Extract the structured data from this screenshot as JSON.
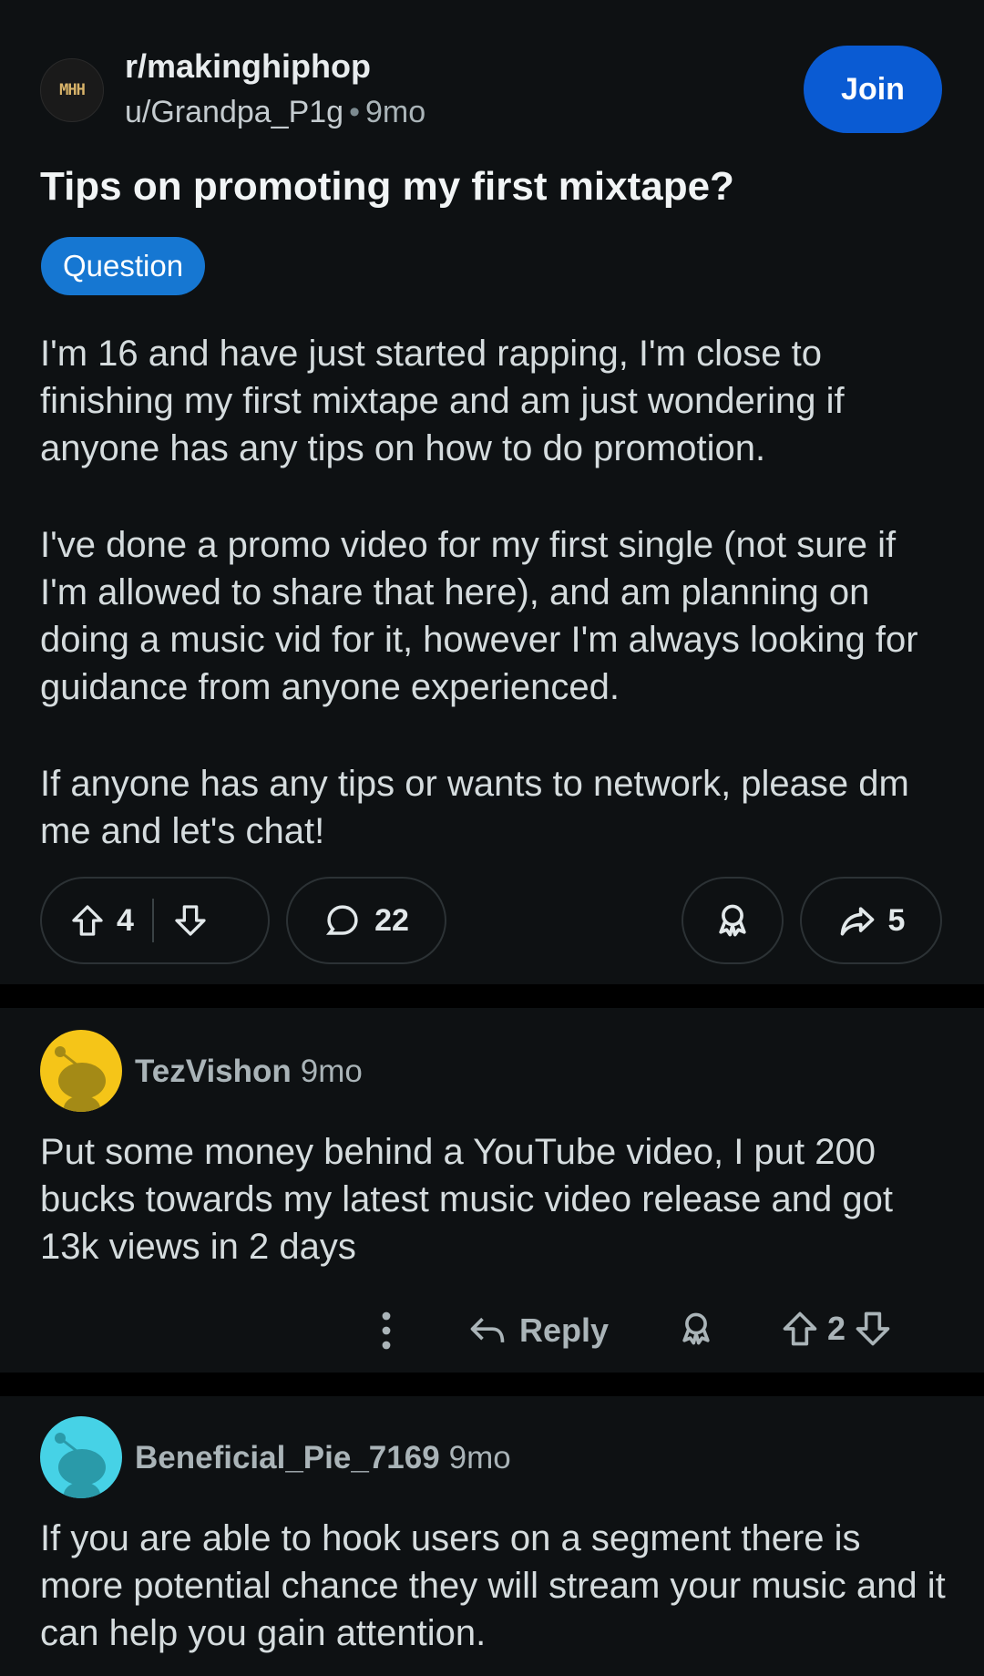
{
  "post": {
    "subreddit_icon_text": "MHH",
    "subreddit": "r/makinghiphop",
    "author": "u/Grandpa_P1g",
    "separator": "•",
    "age": "9mo",
    "join_label": "Join",
    "title": "Tips on promoting my first mixtape?",
    "flair": "Question",
    "paragraphs": [
      "I'm 16 and have just started rapping, I'm close to finishing my first mixtape and am just wondering if anyone has any tips on how to do promotion.",
      "I've done a promo video for my first single (not sure if I'm allowed to share that here), and am planning on doing a music vid for it, however I'm always looking for guidance from anyone experienced.",
      "If anyone has any tips or wants to network, please dm me and let's chat!"
    ],
    "votes": "4",
    "comments": "22",
    "shares": "5"
  },
  "comments": [
    {
      "user": "TezVishon",
      "age": "9mo",
      "avatar_color": "#f5c518",
      "text": "Put some money behind a YouTube video, I put 200 bucks towards my latest music video release and got 13k views in 2 days",
      "reply_label": "Reply",
      "votes": "2"
    },
    {
      "user": "Beneficial_Pie_7169",
      "age": "9mo",
      "avatar_color": "#46d2e6",
      "text": "If you are able to hook users on a segment there is more potential chance they will stream your music and it can help you gain attention."
    }
  ],
  "colors": {
    "join": "#0a5bd3",
    "flair": "#1677d2",
    "background": "#0e1113"
  }
}
